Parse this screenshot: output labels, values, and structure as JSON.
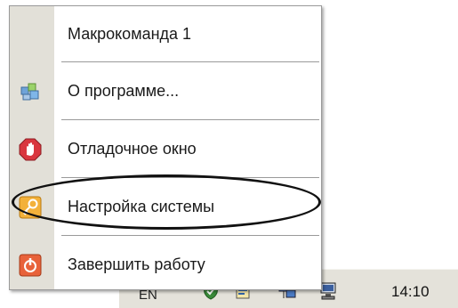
{
  "menu": {
    "items": [
      {
        "label": "Макрокоманда 1",
        "icon": "none"
      },
      {
        "label": "О программе...",
        "icon": "about-icon"
      },
      {
        "label": "Отладочное окно",
        "icon": "stop-hand-icon"
      },
      {
        "label": "Настройка системы",
        "icon": "key-icon"
      },
      {
        "label": "Завершить работу",
        "icon": "power-icon"
      }
    ],
    "highlighted_item": "Настройка системы"
  },
  "taskbar": {
    "language": "EN",
    "clock": "14:10"
  },
  "colors": {
    "gutter": "#e2e0d8",
    "taskbar": "#e4e2da",
    "separator": "#9a9a9a",
    "highlight_outline": "#111111"
  }
}
